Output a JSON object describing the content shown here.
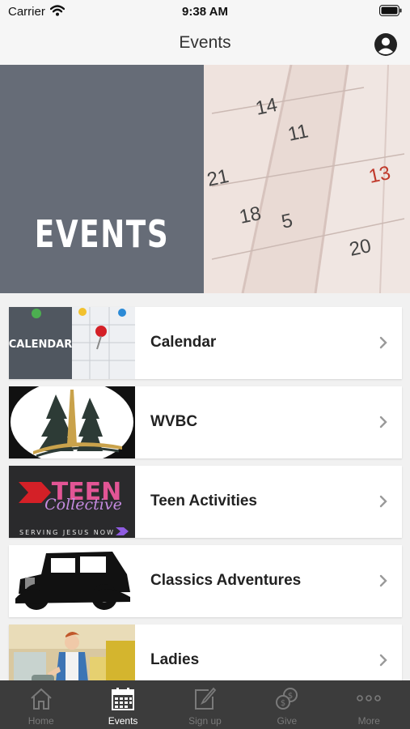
{
  "status": {
    "carrier": "Carrier",
    "time": "9:38 AM"
  },
  "header": {
    "title": "Events"
  },
  "hero": {
    "label": "EVENTS"
  },
  "thumb_text": {
    "calendar": "CALENDAR",
    "teen_big": "TEEN",
    "teen_script": "Collective",
    "teen_tag": "SERVING JESUS NOW"
  },
  "events": [
    {
      "label": "Calendar"
    },
    {
      "label": "WVBC"
    },
    {
      "label": "Teen Activities"
    },
    {
      "label": "Classics Adventures"
    },
    {
      "label": "Ladies"
    }
  ],
  "tabs": [
    {
      "label": "Home",
      "icon": "home-icon",
      "active": false
    },
    {
      "label": "Events",
      "icon": "calendar-icon",
      "active": true
    },
    {
      "label": "Sign up",
      "icon": "edit-icon",
      "active": false
    },
    {
      "label": "Give",
      "icon": "coins-icon",
      "active": false
    },
    {
      "label": "More",
      "icon": "more-icon",
      "active": false
    }
  ],
  "colors": {
    "tab_bar": "#3c3c3c",
    "active_tab": "#ffffff",
    "inactive_tab": "#7a7a7a",
    "hero_overlay": "#5b6470"
  }
}
